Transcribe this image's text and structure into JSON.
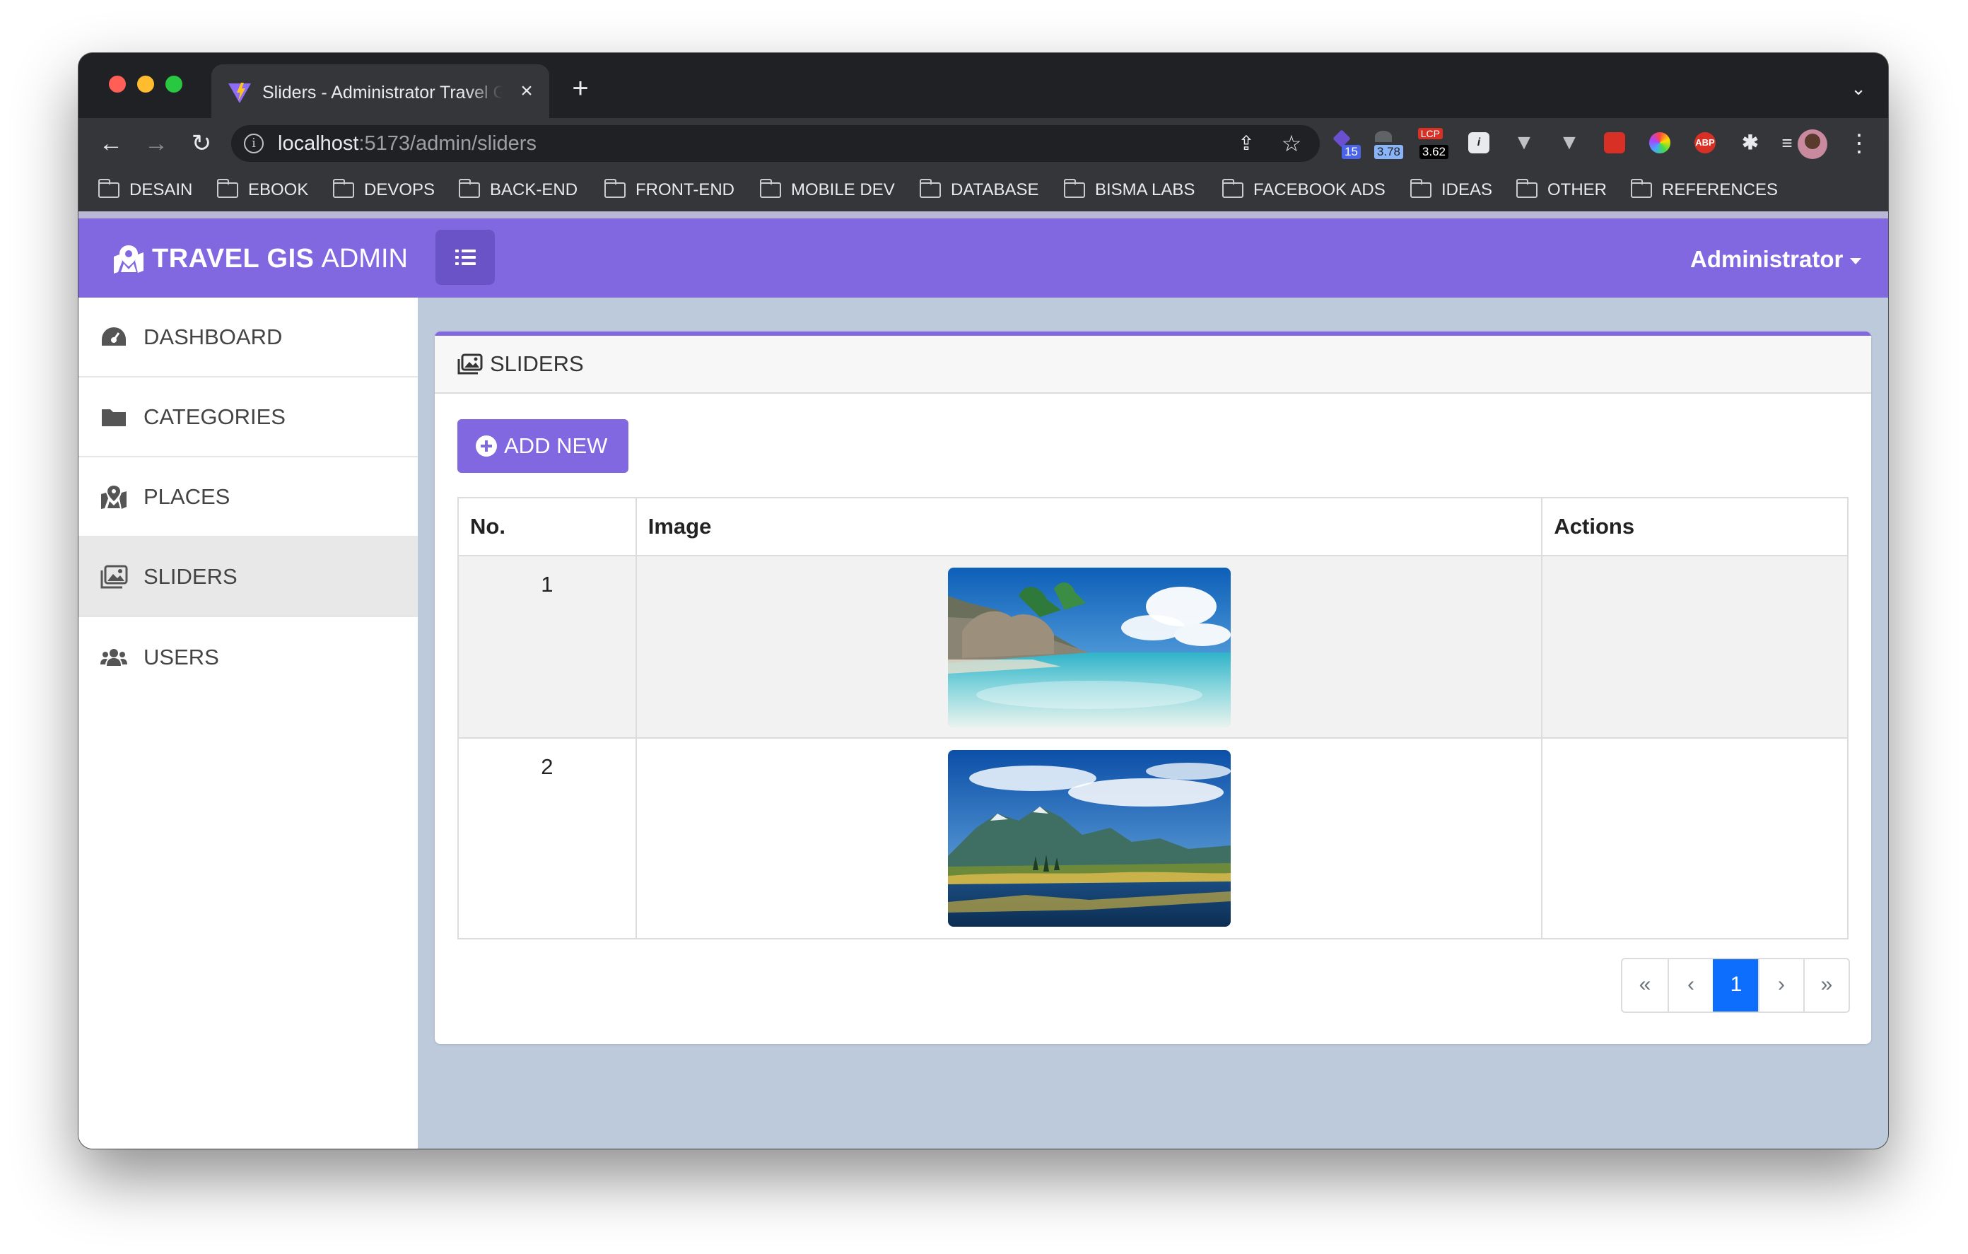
{
  "browser": {
    "tab_title": "Sliders - Administrator Travel GIS",
    "url_host": "localhost",
    "url_path": ":5173/admin/sliders",
    "extension_badges": [
      "15",
      "3.78",
      "LCP",
      "3.62",
      "ABP"
    ],
    "bookmarks": [
      "DESAIN",
      "EBOOK",
      "DEVOPS",
      "BACK-END",
      "FRONT-END",
      "MOBILE DEV",
      "DATABASE",
      "BISMA LABS",
      "FACEBOOK ADS",
      "IDEAS",
      "OTHER",
      "REFERENCES"
    ]
  },
  "app": {
    "brand_strong": "TRAVEL GIS",
    "brand_light": "ADMIN",
    "user_menu": "Administrator",
    "accent_color": "#8167e0"
  },
  "sidebar": {
    "items": [
      {
        "label": "DASHBOARD",
        "icon": "gauge-icon"
      },
      {
        "label": "CATEGORIES",
        "icon": "folder-icon"
      },
      {
        "label": "PLACES",
        "icon": "map-location-icon"
      },
      {
        "label": "SLIDERS",
        "icon": "images-icon",
        "active": true
      },
      {
        "label": "USERS",
        "icon": "users-icon"
      }
    ]
  },
  "main": {
    "card_title": "SLIDERS",
    "add_button": "ADD NEW",
    "table": {
      "headers": [
        "No.",
        "Image",
        "Actions"
      ],
      "rows": [
        {
          "no": "1",
          "image": "tropical-beach-photo",
          "actions": ""
        },
        {
          "no": "2",
          "image": "mountain-lake-photo",
          "actions": ""
        }
      ]
    },
    "pagination": {
      "first": "«",
      "prev": "‹",
      "current": "1",
      "next": "›",
      "last": "»"
    }
  }
}
